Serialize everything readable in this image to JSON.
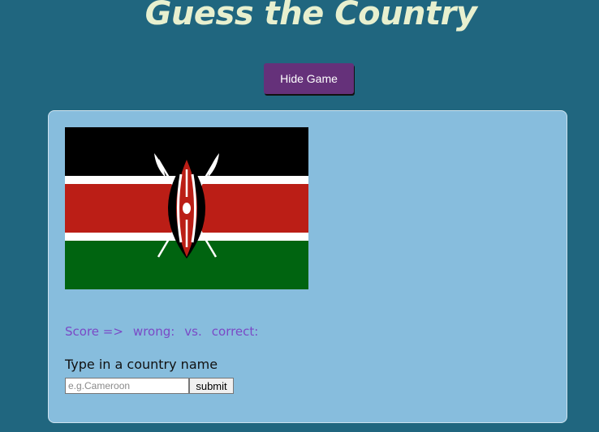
{
  "header": {
    "title": "Guess the Country"
  },
  "controls": {
    "hide_game_label": "Hide Game"
  },
  "game": {
    "flag_image": "kenya-flag",
    "score": {
      "label": "Score =>",
      "wrong_label": "wrong:",
      "vs_label": "vs.",
      "correct_label": "correct:"
    },
    "prompt": "Type in a country name",
    "input_placeholder": "e.g.Cameroon",
    "submit_label": "submit"
  },
  "colors": {
    "background": "#20667f",
    "title": "#e8f0cf",
    "button": "#65317a",
    "card": "#87bddd",
    "score_text": "#7a4ac6"
  }
}
